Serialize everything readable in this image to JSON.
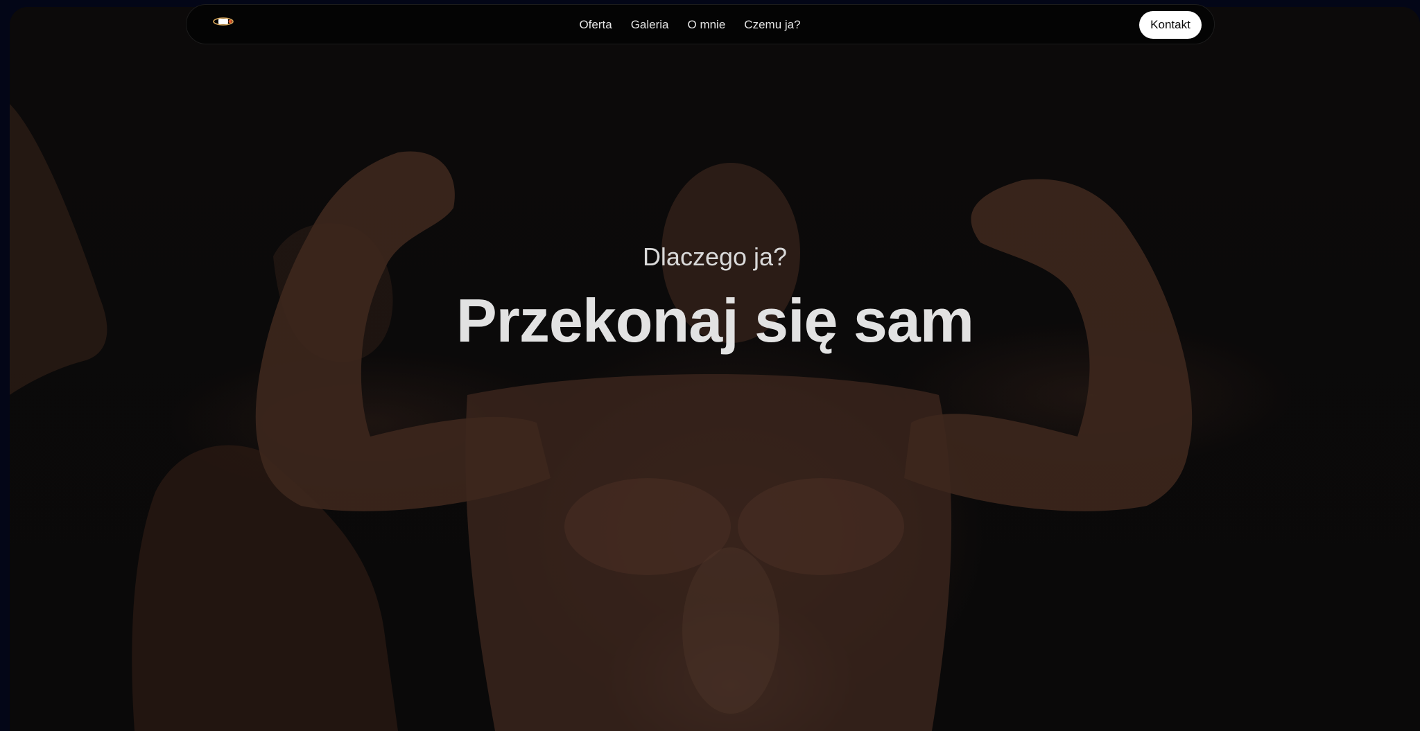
{
  "nav": {
    "logo_icon": "bw-logo-icon",
    "links": [
      "Oferta",
      "Galeria",
      "O mnie",
      "Czemu ja?"
    ],
    "contact_label": "Kontakt"
  },
  "hero": {
    "subtitle": "Dlaczego ja?",
    "title": "Przekonaj się sam",
    "background_image": "bodybuilder-flexing-photo"
  },
  "colors": {
    "page_background": "#030617",
    "hero_background": "#0b0a0a",
    "nav_background": "#040404",
    "button_background": "#ffffff",
    "text": "#e2e2e2"
  }
}
